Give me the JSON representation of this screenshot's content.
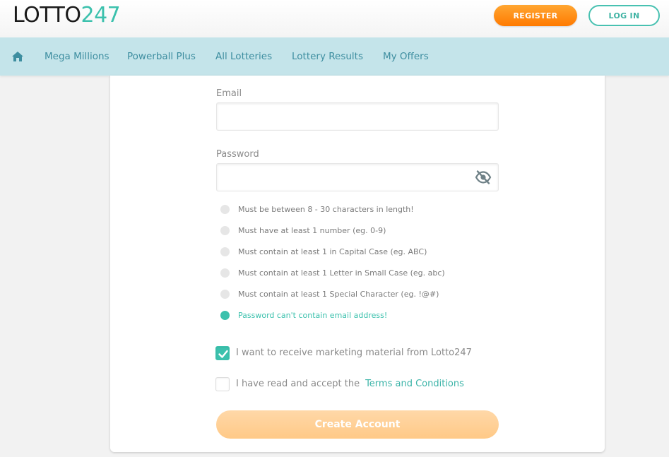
{
  "header": {
    "logo_main": "LOTTO",
    "logo_accent": "247",
    "register_label": "REGISTER",
    "login_label": "LOG IN"
  },
  "nav": {
    "home_icon": "home-icon",
    "items": [
      {
        "label": "Mega Millions"
      },
      {
        "label": "Powerball Plus"
      },
      {
        "label": "All Lotteries"
      },
      {
        "label": "Lottery Results"
      },
      {
        "label": "My Offers"
      }
    ]
  },
  "form": {
    "email_label": "Email",
    "email_value": "",
    "password_label": "Password",
    "password_value": "",
    "password_toggle_icon": "eye-slash-icon",
    "rules": [
      {
        "text": "Must be between 8 - 30 characters in length!",
        "met": false
      },
      {
        "text": "Must have at least 1 number (eg. 0-9)",
        "met": false
      },
      {
        "text": "Must contain at least 1 in Capital Case (eg. ABC)",
        "met": false
      },
      {
        "text": "Must contain at least 1 Letter in Small Case (eg. abc)",
        "met": false
      },
      {
        "text": "Must contain at least 1 Special Character (eg. !@#)",
        "met": false
      },
      {
        "text": "Password can't contain email address!",
        "met": true
      }
    ],
    "marketing_label": "I want to receive marketing material from Lotto247",
    "marketing_checked": true,
    "terms_label": "I have read and accept the",
    "terms_link": "Terms and Conditions",
    "terms_checked": false,
    "submit_label": "Create Account"
  },
  "colors": {
    "accent": "#3cc1ad",
    "nav_bg": "#c4e4ea",
    "register": "#ff8c1a"
  }
}
